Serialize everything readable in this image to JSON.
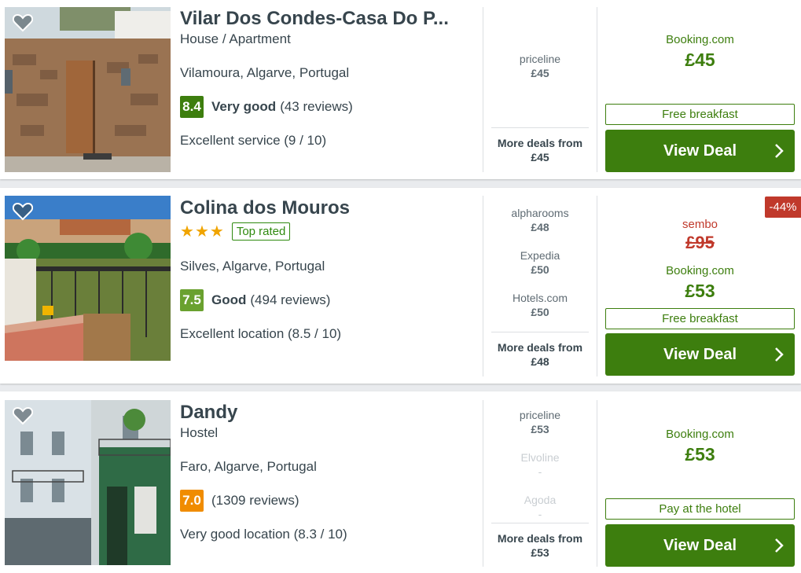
{
  "colors": {
    "deal_green": "#3d7e0e",
    "score_dark_green": "#3d7e0e",
    "score_light_green": "#6aa12f",
    "score_orange": "#f08c00",
    "discount_red": "#c0392b",
    "star_orange": "#f0a400"
  },
  "icons": [
    "heart-icon",
    "chevron-right-icon",
    "star-icon"
  ],
  "listings": [
    {
      "name": "Vilar Dos Condes-Casa Do P...",
      "type": "House / Apartment",
      "location": "Vilamoura, Algarve, Portugal",
      "score": "8.4",
      "rating_label": "Very good",
      "reviews": "(43 reviews)",
      "highlight": "Excellent service (9 / 10)",
      "deals": [
        {
          "provider": "priceline",
          "price": "£45"
        }
      ],
      "more_deals_label": "More deals from",
      "more_deals_price": "£45",
      "best_provider": "Booking.com",
      "best_price": "£45",
      "perk": "Free breakfast",
      "cta": "View Deal"
    },
    {
      "name": "Colina dos Mouros",
      "stars": 3,
      "top_rated": "Top rated",
      "location": "Silves, Algarve, Portugal",
      "score": "7.5",
      "rating_label": "Good",
      "reviews": "(494 reviews)",
      "highlight": "Excellent location (8.5 / 10)",
      "deals": [
        {
          "provider": "alpharooms",
          "price": "£48"
        },
        {
          "provider": "Expedia",
          "price": "£50"
        },
        {
          "provider": "Hotels.com",
          "price": "£50"
        }
      ],
      "more_deals_label": "More deals from",
      "more_deals_price": "£48",
      "discount_badge": "-44%",
      "old_provider": "sembo",
      "old_price": "£95",
      "best_provider": "Booking.com",
      "best_price": "£53",
      "perk": "Free breakfast",
      "cta": "View Deal"
    },
    {
      "name": "Dandy",
      "type": "Hostel",
      "location": "Faro, Algarve, Portugal",
      "score": "7.0",
      "rating_label": "",
      "reviews": "(1309 reviews)",
      "highlight": "Very good location (8.3 / 10)",
      "deals": [
        {
          "provider": "priceline",
          "price": "£53"
        },
        {
          "provider": "Elvoline",
          "price": "-"
        },
        {
          "provider": "Agoda",
          "price": "-"
        }
      ],
      "more_deals_label": "More deals from",
      "more_deals_price": "£53",
      "best_provider": "Booking.com",
      "best_price": "£53",
      "perk": "Pay at the hotel",
      "cta": "View Deal"
    }
  ]
}
